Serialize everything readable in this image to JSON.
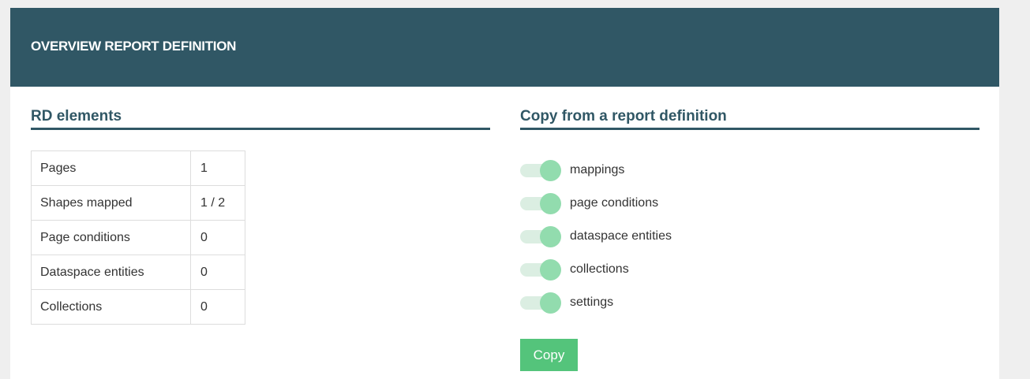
{
  "header": {
    "title": "OVERVIEW REPORT DEFINITION"
  },
  "rd_elements": {
    "title": "RD elements",
    "rows": [
      {
        "label": "Pages",
        "value": "1"
      },
      {
        "label": "Shapes mapped",
        "value": "1 / 2"
      },
      {
        "label": "Page conditions",
        "value": "0"
      },
      {
        "label": "Dataspace entities",
        "value": "0"
      },
      {
        "label": "Collections",
        "value": "0"
      }
    ]
  },
  "copy_section": {
    "title": "Copy from a report definition",
    "toggles": [
      {
        "label": "mappings",
        "checked": true
      },
      {
        "label": "page conditions",
        "checked": true
      },
      {
        "label": "dataspace entities",
        "checked": true
      },
      {
        "label": "collections",
        "checked": true
      },
      {
        "label": "settings",
        "checked": true
      }
    ],
    "button_label": "Copy"
  },
  "colors": {
    "header_bg": "#305765",
    "toggle_knob": "#92dcae",
    "toggle_track": "#dbeee2",
    "button_bg": "#54c47b"
  }
}
